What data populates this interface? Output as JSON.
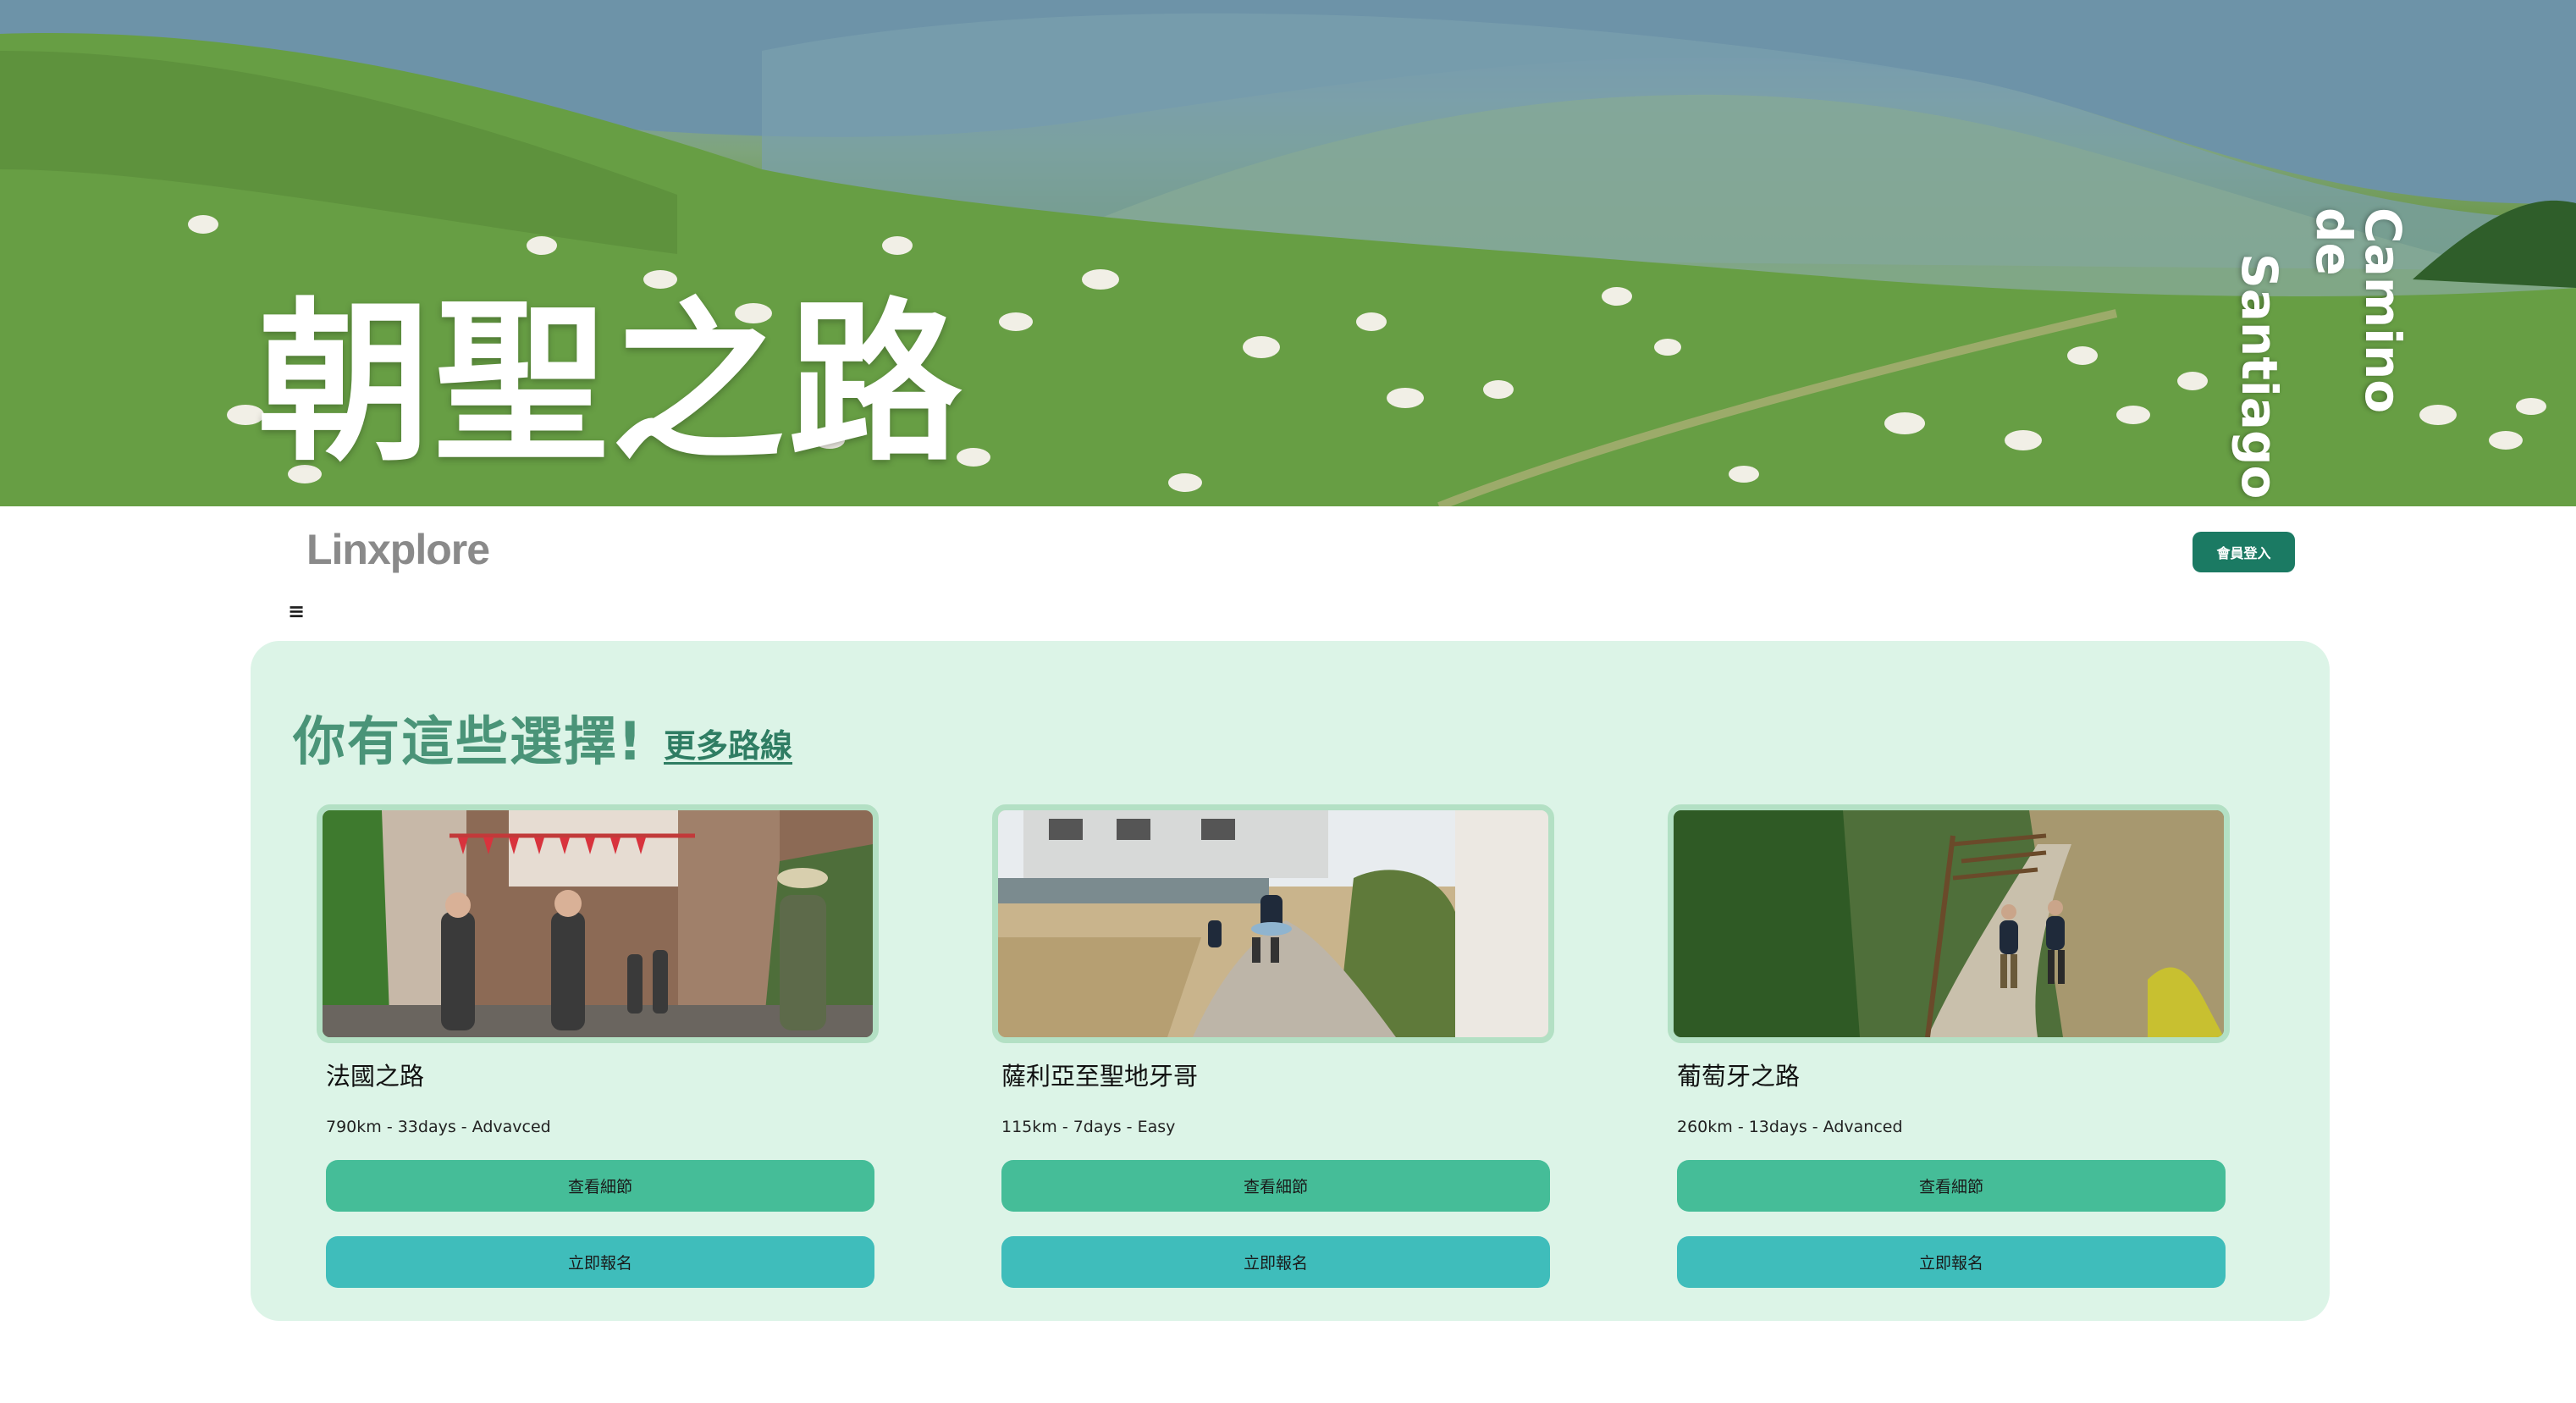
{
  "hero": {
    "title": "朝聖之路",
    "subtitle_line1": "Camino de",
    "subtitle_line2": "Santiago",
    "image": "sheep-on-green-mountain-pasture"
  },
  "nav": {
    "logo": "Linxplore",
    "login_label": "會員登入",
    "menu_icon": "≡"
  },
  "routes_section": {
    "heading": "你有這些選擇!",
    "more_link": "更多路線",
    "cards": [
      {
        "name": "法國之路",
        "meta": "790km - 33days - Advavced",
        "detail_label": "查看細節",
        "signup_label": "立即報名",
        "image": "village-street-with-pilgrims"
      },
      {
        "name": "薩利亞至聖地牙哥",
        "meta": "115km - 7days - Easy",
        "detail_label": "查看細節",
        "signup_label": "立即報名",
        "image": "pilgrims-on-gravel-road"
      },
      {
        "name": "葡萄牙之路",
        "meta": "260km - 13days - Advanced",
        "detail_label": "查看細節",
        "signup_label": "立即報名",
        "image": "hikers-on-forest-trail"
      }
    ]
  },
  "colors": {
    "brand_dark": "#1b7a63",
    "panel_bg": "#dcf4e7",
    "heading": "#4a9478",
    "detail_button": "#45bd98",
    "signup_button": "#3fbdbb"
  }
}
